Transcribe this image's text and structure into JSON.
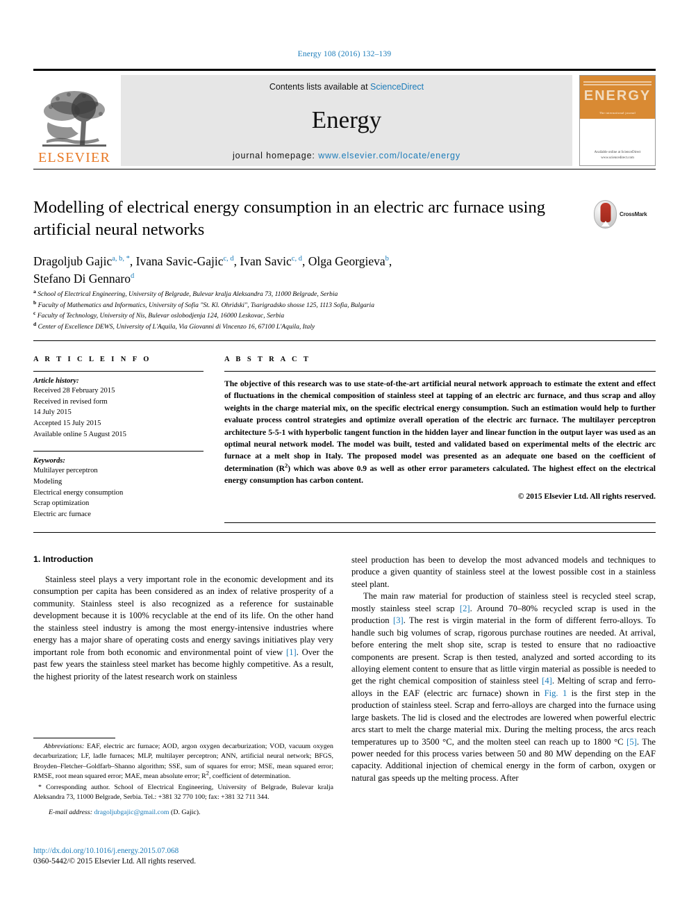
{
  "running_head": "Energy 108 (2016) 132–139",
  "masthead": {
    "contents_prefix": "Contents lists available at ",
    "contents_link": "ScienceDirect",
    "journal_title": "Energy",
    "homepage_prefix": "journal homepage: ",
    "homepage_url": "www.elsevier.com/locate/energy",
    "publisher_name": "ELSEVIER",
    "cover_title": "ENERGY",
    "cover_subtitle": "The international journal",
    "cover_footer": "Available online at\nScienceDirect\nwww.sciencedirect.com"
  },
  "crossmark": {
    "label": "CrossMark"
  },
  "title": "Modelling of electrical energy consumption in an electric arc furnace using artificial neural networks",
  "authors": [
    {
      "name": "Dragoljub Gajic",
      "marks": "a, b, *",
      "sep": ", "
    },
    {
      "name": "Ivana Savic-Gajic",
      "marks": "c, d",
      "sep": ", "
    },
    {
      "name": "Ivan Savic",
      "marks": "c, d",
      "sep": ", "
    },
    {
      "name": "Olga Georgieva",
      "marks": "b",
      "sep": ","
    },
    {
      "name": "Stefano Di Gennaro",
      "marks": "d",
      "sep": ""
    }
  ],
  "affiliations": [
    {
      "mark": "a",
      "text": "School of Electrical Engineering, University of Belgrade, Bulevar kralja Aleksandra 73, 11000 Belgrade, Serbia"
    },
    {
      "mark": "b",
      "text": "Faculty of Mathematics and Informatics, University of Sofia \"St. Kl. Ohridski\", Tsarigradsko shosse 125, 1113 Sofia, Bulgaria"
    },
    {
      "mark": "c",
      "text": "Faculty of Technology, University of Nis, Bulevar oslobodjenja 124, 16000 Leskovac, Serbia"
    },
    {
      "mark": "d",
      "text": "Center of Excellence DEWS, University of L'Aquila, Via Giovanni di Vincenzo 16, 67100 L'Aquila, Italy"
    }
  ],
  "article_info": {
    "heading": "A R T I C L E    I N F O",
    "history_label": "Article history:",
    "history": [
      "Received 28 February 2015",
      "Received in revised form",
      "14 July 2015",
      "Accepted 15 July 2015",
      "Available online 5 August 2015"
    ],
    "keywords_label": "Keywords:",
    "keywords": [
      "Multilayer perceptron",
      "Modeling",
      "Electrical energy consumption",
      "Scrap optimization",
      "Electric arc furnace"
    ]
  },
  "abstract": {
    "heading": "A B S T R A C T",
    "body": "The objective of this research was to use state-of-the-art artificial neural network approach to estimate the extent and effect of fluctuations in the chemical composition of stainless steel at tapping of an electric arc furnace, and thus scrap and alloy weights in the charge material mix, on the specific electrical energy consumption. Such an estimation would help to further evaluate process control strategies and optimize overall operation of the electric arc furnace. The multilayer perceptron architecture 5-5-1 with hyperbolic tangent function in the hidden layer and linear function in the output layer was used as an optimal neural network model. The model was built, tested and validated based on experimental melts of the electric arc furnace at a melt shop in Italy. The proposed model was presented as an adequate one based on the coefficient of determination (R",
    "body_sup": "2",
    "body_cont": ") which was above 0.9 as well as other error parameters calculated. The highest effect on the electrical energy consumption has carbon content.",
    "copyright": "© 2015 Elsevier Ltd. All rights reserved."
  },
  "body": {
    "section_heading": "1. Introduction",
    "left_para_1": "Stainless steel plays a very important role in the economic development and its consumption per capita has been considered as an index of relative prosperity of a community. Stainless steel is also recognized as a reference for sustainable development because it is 100% recyclable at the end of its life. On the other hand the stainless steel industry is among the most energy-intensive industries where energy has a major share of operating costs and energy savings initiatives play very important role from both economic and environmental point of view ",
    "left_ref_1": "[1]",
    "left_para_1b": ". Over the past few years the stainless steel market has become highly competitive. As a result, the highest priority of the latest research work on stainless",
    "right_para_1": "steel production has been to develop the most advanced models and techniques to produce a given quantity of stainless steel at the lowest possible cost in a stainless steel plant.",
    "right_para_2a": "The main raw material for production of stainless steel is recycled steel scrap, mostly stainless steel scrap ",
    "right_ref_2": "[2]",
    "right_para_2b": ". Around 70–80% recycled scrap is used in the production ",
    "right_ref_3": "[3]",
    "right_para_2c": ". The rest is virgin material in the form of different ferro-alloys. To handle such big volumes of scrap, rigorous purchase routines are needed. At arrival, before entering the melt shop site, scrap is tested to ensure that no radioactive components are present. Scrap is then tested, analyzed and sorted according to its alloying element content to ensure that as little virgin material as possible is needed to get the right chemical composition of stainless steel ",
    "right_ref_4": "[4]",
    "right_para_2d": ". Melting of scrap and ferro-alloys in the EAF (electric arc furnace) shown in ",
    "right_ref_fig": "Fig. 1",
    "right_para_2e": " is the first step in the production of stainless steel. Scrap and ferro-alloys are charged into the furnace using large baskets. The lid is closed and the electrodes are lowered when powerful electric arcs start to melt the charge material mix. During the melting process, the arcs reach temperatures up to 3500 °C, and the molten steel can reach up to 1800 °C ",
    "right_ref_5": "[5]",
    "right_para_2f": ". The power needed for this process varies between 50 and 80 MW depending on the EAF capacity. Additional injection of chemical energy in the form of carbon, oxygen or natural gas speeds up the melting process. After"
  },
  "footnotes": {
    "abbrev_label": "Abbreviations:",
    "abbrev_text": " EAF, electric arc furnace; AOD, argon oxygen decarburization; VOD, vacuum oxygen decarburization; LF, ladle furnaces; MLP, multilayer perceptron; ANN, artificial neural network; BFGS, Broyden–Fletcher–Goldfarb–Shanno algorithm; SSE, sum of squares for error; MSE, mean squared error; RMSE, root mean squared error; MAE, mean absolute error; R",
    "abbrev_sup": "2",
    "abbrev_tail": ", coefficient of determination.",
    "corresponding": "* Corresponding author. School of Electrical Engineering, University of Belgrade, Bulevar kralja Aleksandra 73, 11000 Belgrade, Serbia. Tel.: +381 32 770 100; fax: +381 32 711 344.",
    "email_label": "E-mail address:",
    "email_address": "dragoljubgajic@gmail.com",
    "email_owner": " (D. Gajic)."
  },
  "footer": {
    "doi": "http://dx.doi.org/10.1016/j.energy.2015.07.068",
    "issn": "0360-5442/© 2015 Elsevier Ltd. All rights reserved."
  },
  "colors": {
    "link": "#1a7bb9",
    "elsevier_orange": "#E87722",
    "cover_orange": "#d98a33"
  }
}
